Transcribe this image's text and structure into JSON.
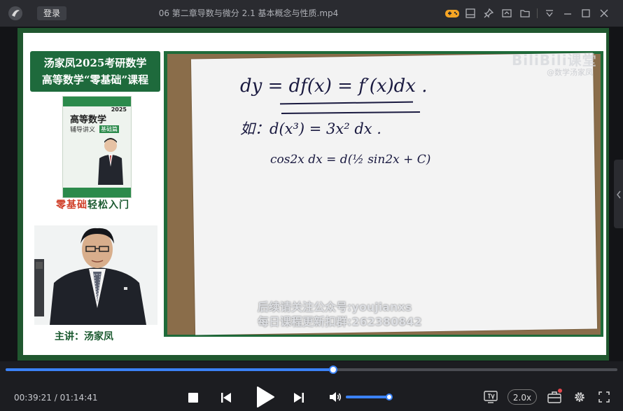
{
  "titlebar": {
    "login_label": "登录",
    "title": "06 第二章导数与微分 2.1 基本概念与性质.mp4"
  },
  "video": {
    "course_title_line1": "汤家凤2025考研数学",
    "course_title_line2": "高等数学“零基础”课程",
    "book": {
      "title": "高等数学",
      "subtitle": "辅导讲义",
      "tag": "基础篇",
      "year": "2025"
    },
    "slogan_part1": "零基础",
    "slogan_part2": "轻松入门",
    "lecturer": "主讲：汤家凤",
    "board": {
      "line1": "dy = df(x) = f′(x)dx .",
      "line2": "如：d(x³) = 3x² dx .",
      "line3": "cos2x dx = d(½ sin2x + C)"
    },
    "watermark_logo": "BiliBili课堂",
    "watermark_author": "@数学汤家凤",
    "overlay_line1": "后续请关注公众号:youjianxs",
    "overlay_line2": "每日课程更新扣群:262380842"
  },
  "player": {
    "current_time": "00:39:21",
    "separator": "/",
    "total_time": "01:14:41",
    "progress": 0.535,
    "volume": 1.0,
    "speed_label": "2.0x"
  },
  "colors": {
    "accent": "#3b82f6",
    "frame_green": "#20572f",
    "slogan_red": "#d0402a"
  }
}
